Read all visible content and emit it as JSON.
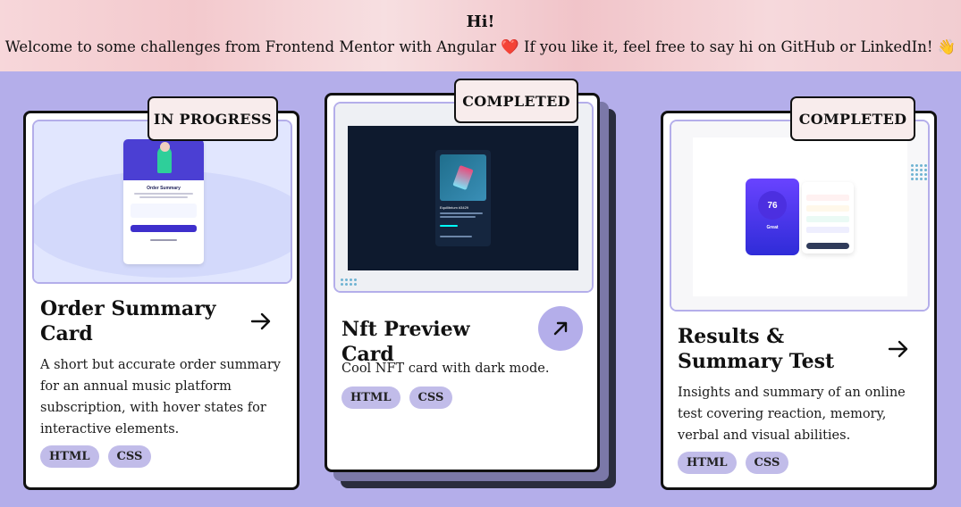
{
  "header": {
    "greeting": "Hi!",
    "welcome_before": "Welcome to some challenges from Frontend Mentor with Angular ",
    "heart": "❤️",
    "welcome_after": " If you like it, feel free to say hi on GitHub or LinkedIn! 👋"
  },
  "cards": [
    {
      "status": "IN PROGRESS",
      "title": "Order Summary Card",
      "description": "A short but accurate order summary for an annual music platform subscription, with hover states for interactive elements.",
      "tags": [
        "HTML",
        "CSS"
      ],
      "link_icon": "arrow-right-icon",
      "preview_text": "Order Summary"
    },
    {
      "status": "COMPLETED",
      "title": "Nft Preview Card",
      "description": "Cool NFT card with dark mode.",
      "tags": [
        "HTML",
        "CSS"
      ],
      "link_icon": "arrow-up-right-icon",
      "preview_text": "Equilibrium #3429"
    },
    {
      "status": "COMPLETED",
      "title": "Results & Summary Test",
      "description": "Insights and summary of an online test covering reaction, memory, verbal and visual abilities.",
      "tags": [
        "HTML",
        "CSS"
      ],
      "link_icon": "arrow-right-icon",
      "preview_score": "76",
      "preview_text": "Great"
    }
  ],
  "colors": {
    "page_background": "#b4aeea",
    "tag_background": "#c1bce9",
    "badge_background": "#f8ecec"
  }
}
